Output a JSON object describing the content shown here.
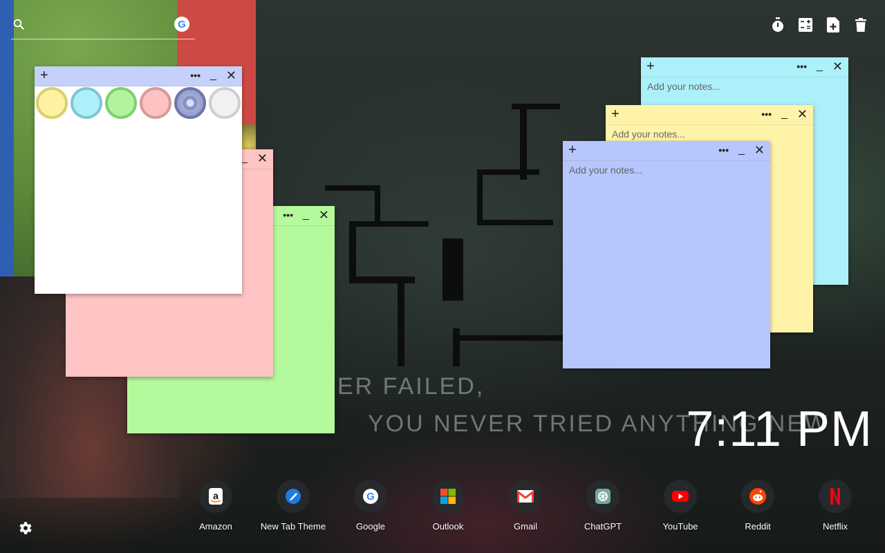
{
  "search": {
    "placeholder": "",
    "google_letter": "G"
  },
  "wallpaper": {
    "line1": "ER FAILED,",
    "line2": "YOU NEVER TRIED ANYTHING NEW"
  },
  "toolbar": {
    "items": [
      {
        "icon": "timer-icon"
      },
      {
        "icon": "calculator-icon"
      },
      {
        "icon": "add-note-icon"
      },
      {
        "icon": "trash-icon"
      }
    ]
  },
  "notes": {
    "add_glyph": "+",
    "menu_glyph": "•••",
    "min_glyph": "_",
    "close_glyph": "✕",
    "placeholder": "Add your notes...",
    "colors": {
      "white": "#ffffff",
      "pink": "#ffc4c4",
      "green": "#b4fa9c",
      "cyan": "#acf0fa",
      "yellow": "#fff3a8",
      "blue": "#b7c6fc",
      "bar_blue": "#c5d0fb"
    },
    "swatches": [
      {
        "name": "yellow",
        "fill": "#fdf2a0",
        "ring": "#d8cf6f"
      },
      {
        "name": "cyan",
        "fill": "#aef0fa",
        "ring": "#7fc6d3"
      },
      {
        "name": "green",
        "fill": "#b3f3a0",
        "ring": "#80cf6e"
      },
      {
        "name": "pink",
        "fill": "#ffc2c2",
        "ring": "#d69a9a"
      },
      {
        "name": "blue",
        "fill": "#8792c0",
        "ring": "#6c77a6"
      },
      {
        "name": "white",
        "fill": "#f1f1f1",
        "ring": "#cfcfcf"
      }
    ]
  },
  "clock": {
    "time": "7:11 PM"
  },
  "dock": {
    "items": [
      {
        "label": "Amazon",
        "icon": "amazon-icon"
      },
      {
        "label": "New Tab Theme",
        "icon": "new-tab-theme-icon"
      },
      {
        "label": "Google",
        "icon": "google-icon"
      },
      {
        "label": "Outlook",
        "icon": "outlook-icon"
      },
      {
        "label": "Gmail",
        "icon": "gmail-icon"
      },
      {
        "label": "ChatGPT",
        "icon": "chatgpt-icon"
      },
      {
        "label": "YouTube",
        "icon": "youtube-icon"
      },
      {
        "label": "Reddit",
        "icon": "reddit-icon"
      },
      {
        "label": "Netflix",
        "icon": "netflix-icon"
      }
    ]
  }
}
